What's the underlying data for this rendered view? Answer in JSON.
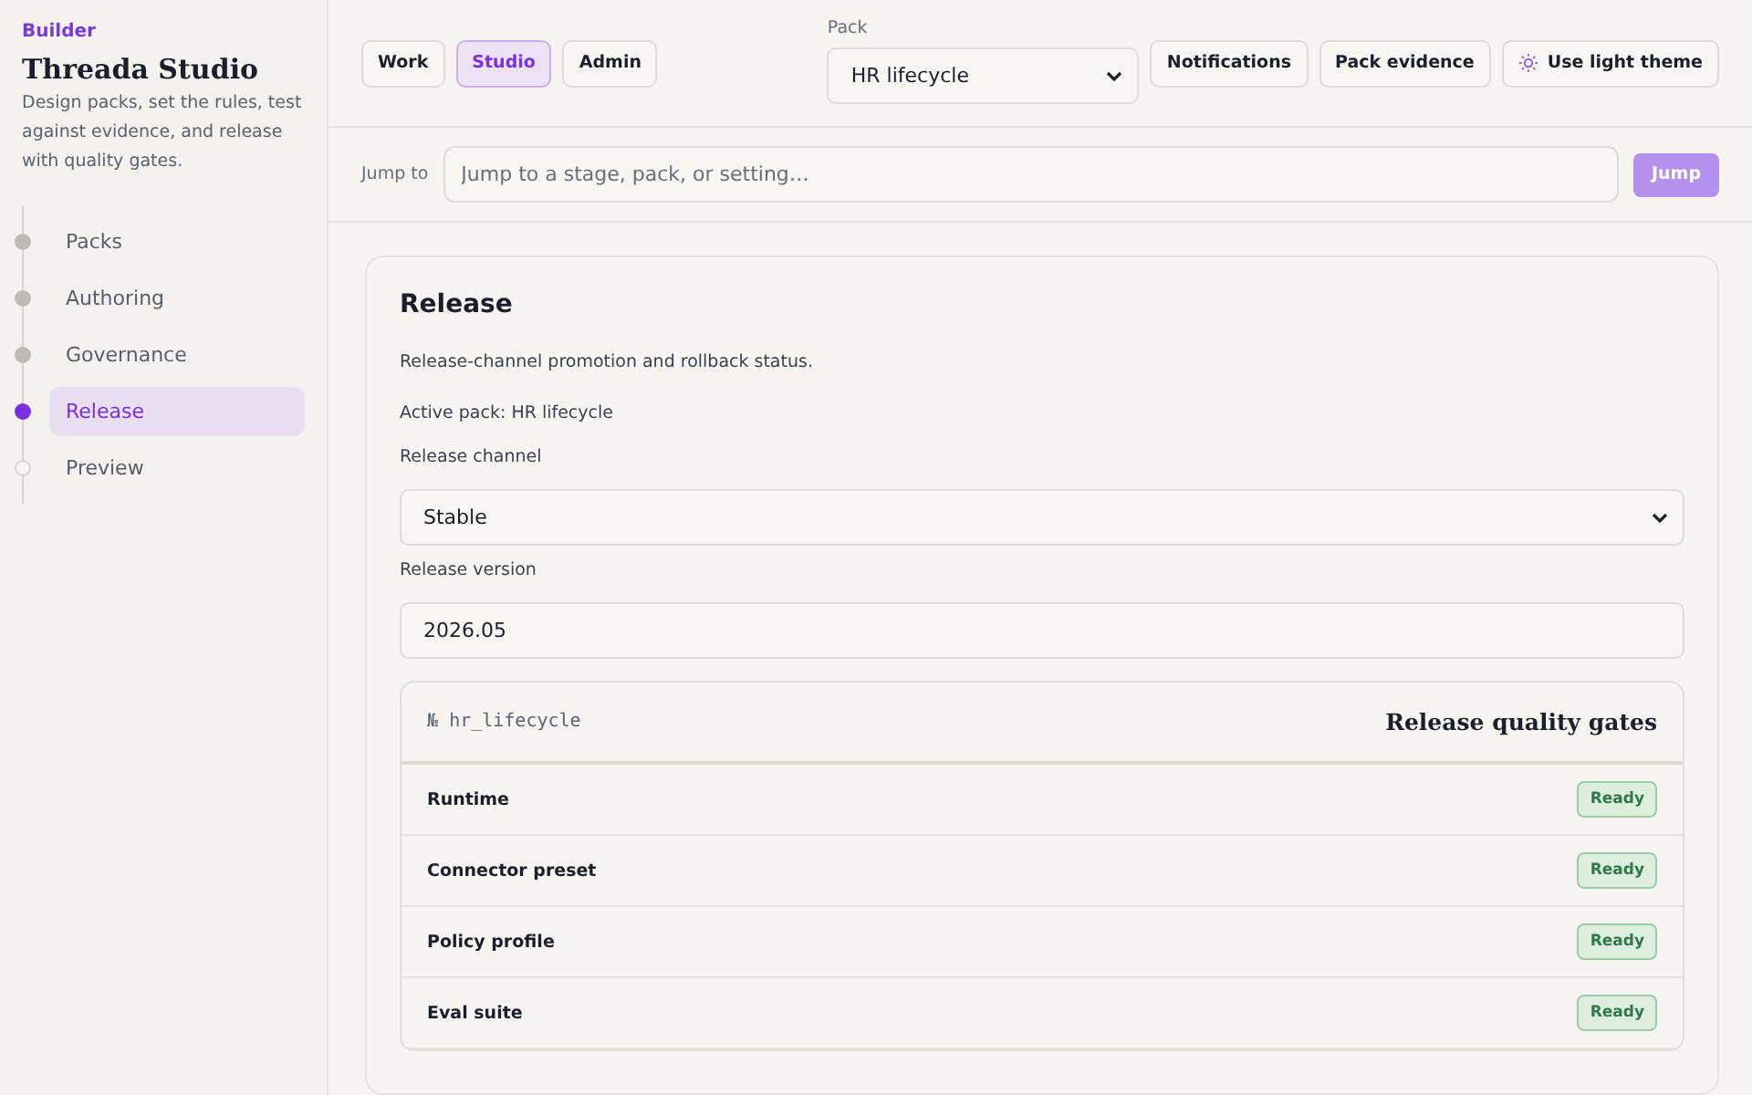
{
  "sidebar": {
    "eyebrow": "Builder",
    "title": "Threada Studio",
    "description": "Design packs, set the rules, test against evidence, and release with quality gates.",
    "steps": [
      {
        "label": "Packs",
        "done": true,
        "selected": false
      },
      {
        "label": "Authoring",
        "done": true,
        "selected": false
      },
      {
        "label": "Governance",
        "done": true,
        "selected": false
      },
      {
        "label": "Release",
        "done": false,
        "selected": true
      },
      {
        "label": "Preview",
        "done": false,
        "selected": false
      }
    ]
  },
  "topbar": {
    "modes": [
      {
        "label": "Work",
        "selected": false
      },
      {
        "label": "Studio",
        "selected": true
      },
      {
        "label": "Admin",
        "selected": false
      }
    ],
    "pack": {
      "label": "Pack",
      "value": "HR lifecycle"
    },
    "actions": [
      {
        "label": "Notifications",
        "kind": "plain"
      },
      {
        "label": "Pack evidence",
        "kind": "plain"
      },
      {
        "label": "Use light theme",
        "kind": "theme"
      }
    ]
  },
  "jump": {
    "label": "Jump to",
    "placeholder": "Jump to a stage, pack, or setting…",
    "button": "Jump"
  },
  "release": {
    "title": "Release",
    "description": "Release-channel promotion and rollback status.",
    "active_pack": "Active pack: HR lifecycle",
    "channel": {
      "label": "Release channel",
      "value": "Stable"
    },
    "version": {
      "label": "Release version",
      "value": "2026.05"
    },
    "gates": {
      "pack_mark": "№",
      "pack_id": "hr_lifecycle",
      "title": "Release quality gates",
      "rows": [
        {
          "name": "Runtime",
          "status": "Ready"
        },
        {
          "name": "Connector preset",
          "status": "Ready"
        },
        {
          "name": "Policy profile",
          "status": "Ready"
        },
        {
          "name": "Eval suite",
          "status": "Ready"
        }
      ]
    }
  }
}
